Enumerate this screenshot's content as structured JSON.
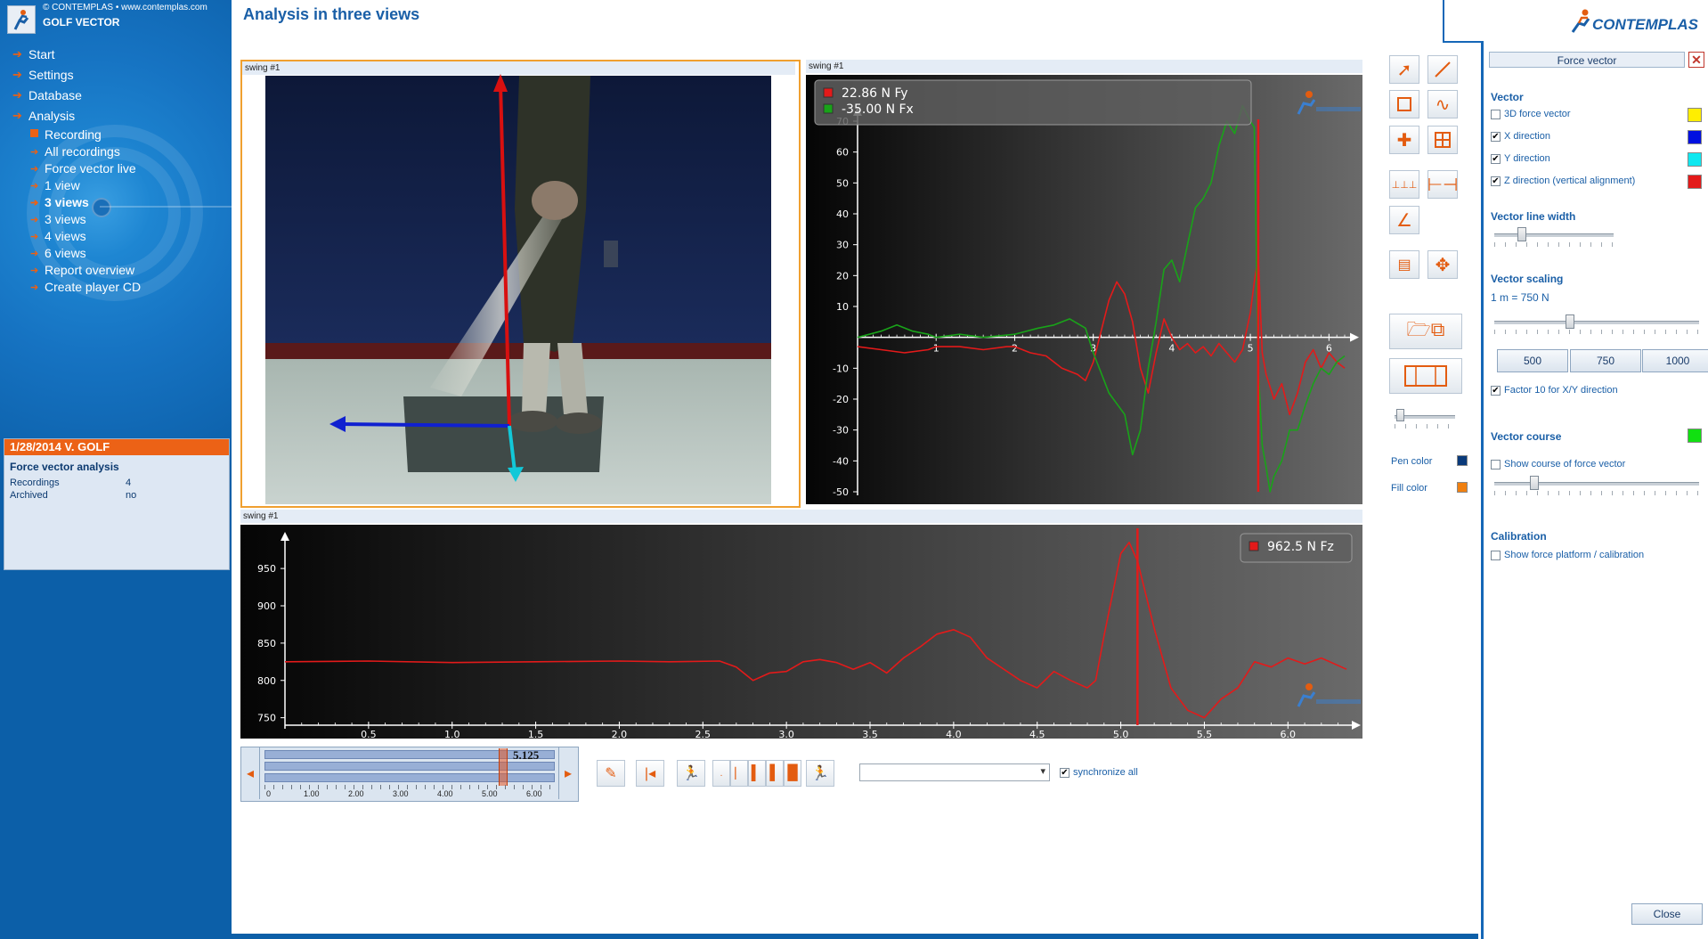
{
  "app": {
    "copyright": "© CONTEMPLAS • www.contemplas.com",
    "title": "GOLF VECTOR",
    "brand": "CONTEMPLAS"
  },
  "sidebar": {
    "nav": [
      {
        "label": "Start"
      },
      {
        "label": "Settings"
      },
      {
        "label": "Database"
      },
      {
        "label": "Analysis"
      }
    ],
    "sub": [
      {
        "label": "Recording"
      },
      {
        "label": "All recordings"
      },
      {
        "label": "Force vector live"
      },
      {
        "label": "1 view"
      },
      {
        "label": "3 views"
      },
      {
        "label": "3 views"
      },
      {
        "label": "4 views"
      },
      {
        "label": "6 views"
      },
      {
        "label": "Report overview"
      },
      {
        "label": "Create player CD"
      }
    ],
    "info": {
      "header": "1/28/2014 V. GOLF",
      "title": "Force vector analysis",
      "recordings_label": "Recordings",
      "recordings_value": "4",
      "archived_label": "Archived",
      "archived_value": "no"
    }
  },
  "header": {
    "title": "Analysis in three views"
  },
  "panes": {
    "video_label": "swing #1",
    "xy_label": "swing #1",
    "z_label": "swing #1"
  },
  "chart_data": [
    {
      "type": "line",
      "legend": [
        {
          "color": "#e31a1a",
          "label": "22.86 N Fy"
        },
        {
          "color": "#19a319",
          "label": "-35.00 N Fx"
        }
      ],
      "ylim": [
        -50,
        70
      ],
      "yticks": [
        70,
        60,
        50,
        40,
        30,
        20,
        10,
        -10,
        -20,
        -30,
        -40,
        -50
      ],
      "xlim": [
        0,
        6.2
      ],
      "xticks": [
        1,
        2,
        3,
        4,
        5,
        6
      ],
      "cursor_x": 5.1,
      "series": [
        {
          "color": "#e31a1a",
          "x": [
            0.0,
            0.3,
            0.6,
            0.9,
            1.0,
            1.3,
            1.6,
            1.9,
            2.0,
            2.2,
            2.4,
            2.6,
            2.8,
            2.9,
            3.0,
            3.1,
            3.2,
            3.3,
            3.4,
            3.5,
            3.6,
            3.7,
            3.8,
            3.9,
            4.0,
            4.1,
            4.2,
            4.3,
            4.4,
            4.5,
            4.6,
            4.7,
            4.8,
            4.9,
            5.0,
            5.05,
            5.1,
            5.15,
            5.2,
            5.3,
            5.4,
            5.5,
            5.6,
            5.7,
            5.8,
            5.9,
            6.0,
            6.1,
            6.2
          ],
          "y": [
            -3,
            -4,
            -5,
            -4,
            -3,
            -3,
            -4,
            -3,
            -3,
            -5,
            -6,
            -10,
            -12,
            -14,
            -8,
            2,
            12,
            18,
            14,
            5,
            -10,
            -18,
            -5,
            6,
            0,
            -4,
            -2,
            -5,
            -3,
            -6,
            -2,
            -5,
            -8,
            -4,
            8,
            18,
            26,
            -5,
            -12,
            -20,
            -15,
            -25,
            -18,
            -8,
            -4,
            -10,
            -5,
            -8,
            -10
          ]
        },
        {
          "color": "#19a319",
          "x": [
            0.0,
            0.3,
            0.5,
            0.7,
            0.9,
            1.0,
            1.3,
            1.6,
            2.0,
            2.3,
            2.5,
            2.7,
            2.9,
            3.0,
            3.2,
            3.4,
            3.5,
            3.6,
            3.7,
            3.8,
            3.9,
            4.0,
            4.1,
            4.2,
            4.3,
            4.4,
            4.5,
            4.6,
            4.7,
            4.8,
            4.9,
            5.0,
            5.05,
            5.1,
            5.15,
            5.2,
            5.25,
            5.3,
            5.4,
            5.5,
            5.6,
            5.7,
            5.8,
            5.9,
            6.0,
            6.1,
            6.2
          ],
          "y": [
            0,
            2,
            4,
            2,
            1,
            0,
            1,
            0,
            1,
            3,
            4,
            6,
            3,
            -5,
            -18,
            -25,
            -38,
            -30,
            -10,
            5,
            22,
            25,
            18,
            30,
            42,
            45,
            50,
            62,
            70,
            66,
            75,
            70,
            68,
            -10,
            -35,
            -42,
            -50,
            -45,
            -40,
            -30,
            -30,
            -22,
            -15,
            -10,
            -12,
            -8,
            -6
          ]
        }
      ]
    },
    {
      "type": "line",
      "legend": [
        {
          "color": "#e31a1a",
          "label": "962.5 N Fz"
        }
      ],
      "ylim": [
        740,
        980
      ],
      "yticks": [
        950,
        900,
        850,
        800,
        750
      ],
      "xlim": [
        0,
        6.35
      ],
      "xticks": [
        "0.5",
        "1.0",
        "1.5",
        "2.0",
        "2.5",
        "3.0",
        "3.5",
        "4.0",
        "4.5",
        "5.0",
        "5.5",
        "6.0"
      ],
      "cursor_x": 5.1,
      "series": [
        {
          "color": "#e31a1a",
          "x": [
            0.0,
            0.5,
            1.0,
            1.5,
            2.0,
            2.3,
            2.6,
            2.7,
            2.8,
            2.9,
            3.0,
            3.1,
            3.2,
            3.3,
            3.4,
            3.5,
            3.6,
            3.7,
            3.8,
            3.9,
            4.0,
            4.1,
            4.2,
            4.3,
            4.4,
            4.5,
            4.6,
            4.7,
            4.8,
            4.85,
            4.9,
            5.0,
            5.05,
            5.1,
            5.2,
            5.3,
            5.4,
            5.5,
            5.6,
            5.7,
            5.8,
            5.9,
            6.0,
            6.1,
            6.2,
            6.35
          ],
          "y": [
            825,
            826,
            824,
            825,
            826,
            825,
            826,
            818,
            800,
            810,
            812,
            825,
            828,
            824,
            815,
            824,
            810,
            830,
            845,
            862,
            868,
            858,
            830,
            815,
            800,
            790,
            812,
            800,
            790,
            800,
            860,
            970,
            985,
            960,
            870,
            790,
            760,
            750,
            775,
            790,
            825,
            818,
            830,
            822,
            830,
            815
          ]
        }
      ]
    }
  ],
  "tools": {
    "pen_color_label": "Pen color",
    "fill_color_label": "Fill color",
    "pen_color": "#0a3a7a",
    "fill_color": "#f08010"
  },
  "right_panel": {
    "title": "Force vector",
    "close_x": "✕",
    "vector_section": "Vector",
    "options": [
      {
        "label": "3D force vector",
        "checked": false,
        "color": "#ffee00"
      },
      {
        "label": "X direction",
        "checked": true,
        "color": "#0010e0"
      },
      {
        "label": "Y direction",
        "checked": true,
        "color": "#10e8f0"
      },
      {
        "label": "Z direction (vertical alignment)",
        "checked": true,
        "color": "#e31a1a"
      }
    ],
    "line_width_section": "Vector line width",
    "scaling_section": "Vector scaling",
    "scaling_value": "1 m = 750 N",
    "scale_buttons": [
      "500",
      "750",
      "1000"
    ],
    "factor_label": "Factor 10 for X/Y direction",
    "course_section": "Vector course",
    "course_color": "#11e011",
    "course_label": "Show course of force vector",
    "calibration_section": "Calibration",
    "calibration_label": "Show force platform / calibration",
    "close_button": "Close"
  },
  "timeline": {
    "value": "5.125",
    "ticks": [
      "0",
      "1.00",
      "2.00",
      "3.00",
      "4.00",
      "5.00",
      "6.00"
    ],
    "sync_label": "synchronize all",
    "position": 0.82
  }
}
